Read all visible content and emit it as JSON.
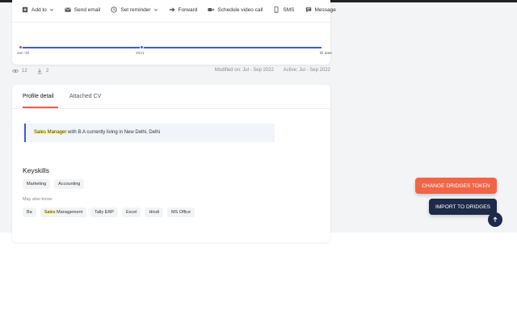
{
  "toolbar": {
    "items": [
      {
        "label": "Add to",
        "icon": "bookmark-add-icon"
      },
      {
        "label": "Send email",
        "icon": "email-icon"
      },
      {
        "label": "Set reminder",
        "icon": "clock-icon"
      },
      {
        "label": "Forward",
        "icon": "forward-arrow-icon"
      },
      {
        "label": "Schedule video call",
        "icon": "video-camera-icon"
      },
      {
        "label": "SMS",
        "icon": "phone-icon"
      },
      {
        "label": "Message",
        "icon": "chat-icon"
      }
    ]
  },
  "timeline": {
    "start_label": "Jan '20",
    "mid_label": "2021",
    "end_label": "till date"
  },
  "meta": {
    "views": "12",
    "downloads": "2",
    "modified": "Modified on: Jul - Sep 2022",
    "active": "Active: Jul - Sep 2022"
  },
  "tabs": [
    {
      "label": "Profile detail"
    },
    {
      "label": "Attached CV"
    }
  ],
  "summary": {
    "highlight": "Sales Manager",
    "rest": " with B.A currently living in New Delhi, Delhi"
  },
  "keyskills": {
    "title": "Keyskills",
    "skills": [
      "Marketing",
      "Accounting"
    ],
    "also_label": "May also know",
    "also": [
      {
        "highlight": "",
        "text": "Ba"
      },
      {
        "highlight": "Sales",
        "text": " Management"
      },
      {
        "highlight": "",
        "text": "Tally ERP"
      },
      {
        "highlight": "",
        "text": "Excel"
      },
      {
        "highlight": "",
        "text": "Hindi"
      },
      {
        "highlight": "",
        "text": "MS Office"
      }
    ]
  },
  "buttons": {
    "change_token": "CHANGE DRIDGES TOKEN",
    "import": "IMPORT TO DRIDGES"
  },
  "colors": {
    "accent_blue": "#3b5bdb",
    "accent_orange": "#f06548",
    "navy": "#1f2a4a",
    "highlight": "#fff9a8"
  }
}
